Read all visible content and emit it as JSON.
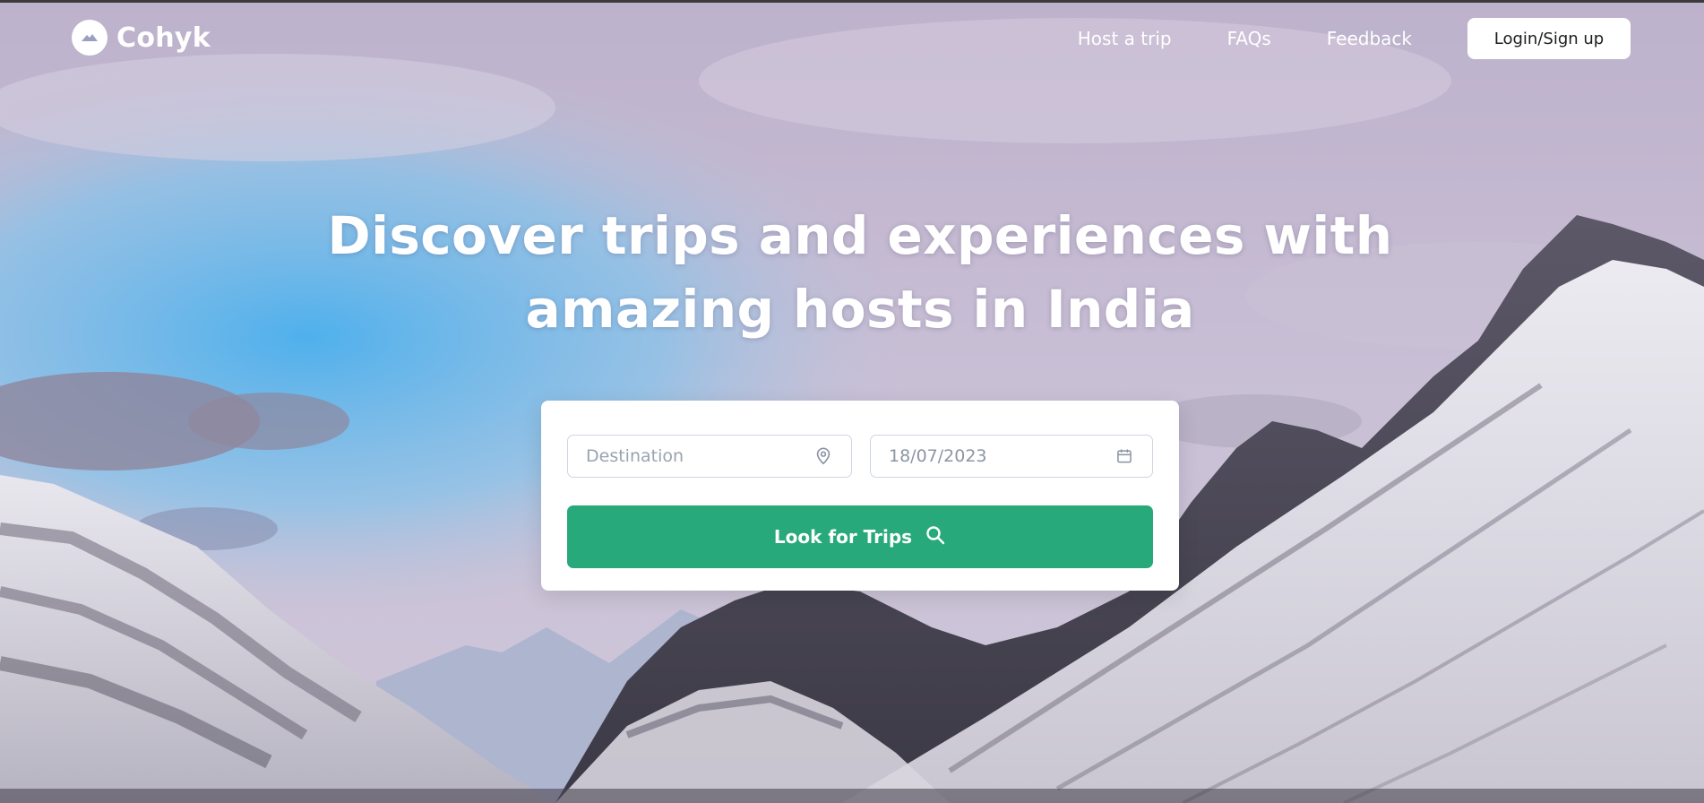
{
  "brand": {
    "name": "Cohyk",
    "logo_icon": "mountain-icon"
  },
  "nav": {
    "links": [
      "Host a trip",
      "FAQs",
      "Feedback"
    ],
    "login_label": "Login/Sign up"
  },
  "hero": {
    "headline_line1": "Discover trips and experiences with",
    "headline_line2": "amazing hosts in India"
  },
  "search": {
    "destination_placeholder": "Destination",
    "destination_icon": "location-pin-icon",
    "date_value": "18/07/2023",
    "date_icon": "calendar-icon",
    "button_label": "Look for Trips",
    "button_icon": "search-icon"
  },
  "colors": {
    "accent": "#27a97b",
    "text_on_hero": "#ffffff",
    "field_border": "#cfd6e0"
  }
}
